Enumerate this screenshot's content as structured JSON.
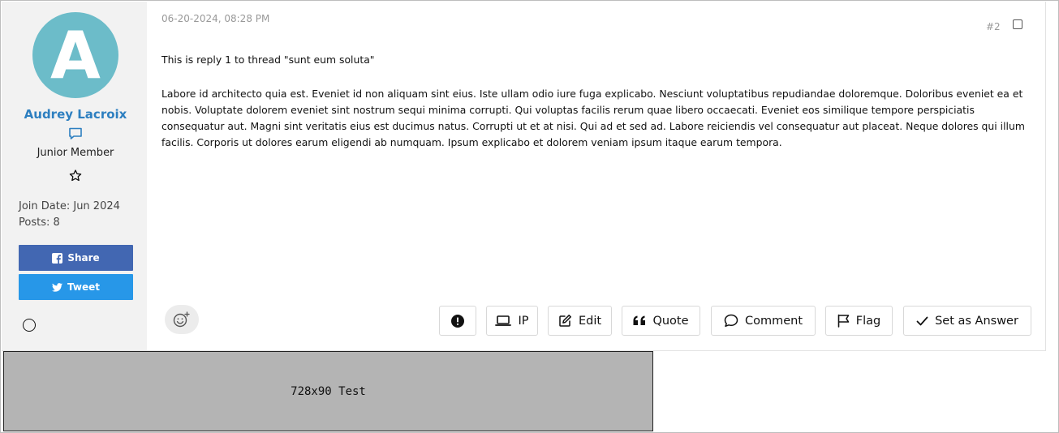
{
  "user": {
    "avatar_letter": "A",
    "avatar_color": "#6cbcc9",
    "name": "Audrey Lacroix",
    "rank": "Junior Member",
    "join_date": "Join Date: Jun 2024",
    "posts": "Posts: 8"
  },
  "social": {
    "share_label": "Share",
    "tweet_label": "Tweet",
    "share_color": "#4267b2",
    "tweet_color": "#2797e8"
  },
  "post": {
    "timestamp": "06-20-2024, 08:28 PM",
    "number": "#2",
    "title_line": "This is reply 1 to thread \"sunt eum soluta\"",
    "body": "Labore id architecto quia est. Eveniet id non aliquam sint eius. Iste ullam odio iure fuga explicabo. Nesciunt voluptatibus repudiandae doloremque. Doloribus eveniet ea et nobis. Voluptate dolorem eveniet sint nostrum sequi minima corrupti. Qui voluptas facilis rerum quae libero occaecati. Eveniet eos similique tempore perspiciatis consequatur aut. Magni sint veritatis eius est ducimus natus. Corrupti ut et at nisi. Qui ad et sed ad. Labore reiciendis vel consequatur aut placeat. Neque dolores qui illum facilis. Corporis ut dolores earum eligendi ab numquam. Ipsum explicabo et dolorem veniam ipsum itaque earum tempora."
  },
  "actions": {
    "ip": "IP",
    "edit": "Edit",
    "quote": "Quote",
    "comment": "Comment",
    "flag": "Flag",
    "answer": "Set as Answer"
  },
  "ad": {
    "label": "728x90 Test"
  },
  "icons": [
    "chat-bubble-icon",
    "star-outline-icon",
    "facebook-icon",
    "twitter-icon",
    "status-circle-icon",
    "emoji-add-icon",
    "report-icon",
    "laptop-icon",
    "edit-icon",
    "quote-icon",
    "comment-icon",
    "flag-icon",
    "check-icon"
  ]
}
